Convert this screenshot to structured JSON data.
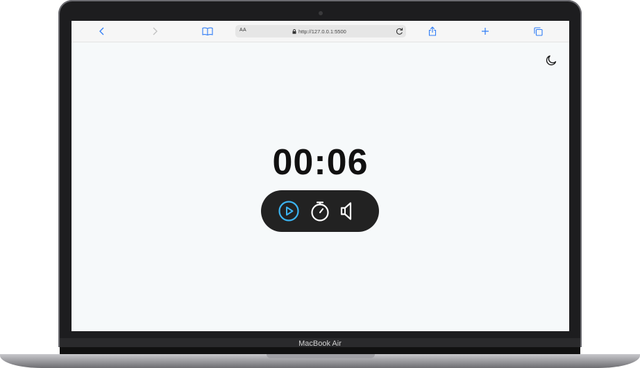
{
  "device": {
    "brand_label": "MacBook Air"
  },
  "browser": {
    "text_size_label": "AA",
    "url": "http://127.0.0.1:5500",
    "accent_color": "#2e7cf6",
    "icons": [
      "back-icon",
      "forward-icon",
      "bookmarks-icon",
      "lock-icon",
      "reload-icon",
      "share-icon",
      "new-tab-icon",
      "tabs-icon"
    ]
  },
  "app": {
    "timer_value": "00:06",
    "theme_icon": "moon-icon",
    "controls": {
      "play_icon": "play-icon",
      "stopwatch_icon": "stopwatch-icon",
      "sound_icon": "speaker-icon",
      "active_color": "#3bb4f2"
    },
    "background_color": "#f6f9fa",
    "pill_color": "#222222"
  }
}
